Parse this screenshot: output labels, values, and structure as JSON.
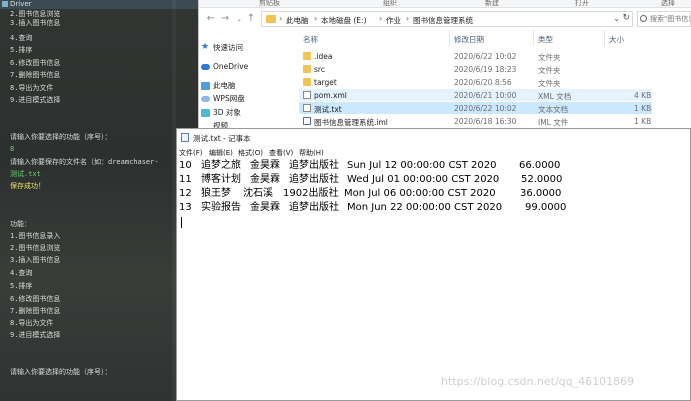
{
  "console": {
    "title": "Driver",
    "lines_top": [
      "2.图书信息浏览",
      "3.插入图书信息",
      "4.查询",
      "5.排序",
      "6.修改图书信息",
      "7.删除图书信息",
      "8.导出为文件",
      "9.进目模式选择"
    ],
    "prompt_function": "请输入你要选择的功能（序号）：",
    "input_value": "8",
    "prompt_filename": "请输入你要保存的文件名（如：dreamchaser-",
    "filename_value": "测试.txt",
    "save_success": "保存成功！",
    "function_header": "功能：",
    "lines_bottom": [
      "1.图书信息录入",
      "2.图书信息浏览",
      "3.插入图书信息",
      "4.查询",
      "5.排序",
      "6.修改图书信息",
      "7.删除图书信息",
      "8.导出为文件",
      "9.进目模式选择"
    ],
    "prompt_function_2": "请输入你要选择的功能（序号）："
  },
  "explorer": {
    "ribbon": [
      "剪贴板",
      "组织",
      "新建",
      "打开",
      "选择"
    ],
    "breadcrumbs": [
      "此电脑",
      "本地磁盘 (E:)",
      "作业",
      "图书信息管理系统"
    ],
    "search_placeholder": "搜索\"图书信息",
    "nav_items": [
      "快速访问",
      "OneDrive",
      "此电脑",
      "WPS网盘",
      "3D 对象",
      "视频"
    ],
    "columns": {
      "name": "名称",
      "date": "修改日期",
      "type": "类型",
      "size": "大小"
    },
    "files": [
      {
        "name": ".idea",
        "date": "2020/6/22 10:02",
        "type": "文件夹",
        "size": "",
        "icon": "folder"
      },
      {
        "name": "src",
        "date": "2020/6/19 18:23",
        "type": "文件夹",
        "size": "",
        "icon": "folder"
      },
      {
        "name": "target",
        "date": "2020/6/20 8:56",
        "type": "文件夹",
        "size": "",
        "icon": "folder"
      },
      {
        "name": "pom.xml",
        "date": "2020/6/21 10:00",
        "type": "XML 文档",
        "size": "4 KB",
        "icon": "file"
      },
      {
        "name": "测试.txt",
        "date": "2020/6/22 10:02",
        "type": "文本文档",
        "size": "1 KB",
        "icon": "file"
      },
      {
        "name": "图书信息管理系统.iml",
        "date": "2020/6/18 16:30",
        "type": "IML 文件",
        "size": "1 KB",
        "icon": "iml"
      }
    ]
  },
  "notepad": {
    "title": "测试.txt - 记事本",
    "menu": [
      "文件(F)",
      "编辑(E)",
      "格式(O)",
      "查看(V)",
      "帮助(H)"
    ],
    "rows": [
      {
        "id": "10",
        "title": "追梦之旅",
        "author": "金昊霖",
        "publisher": "追梦出版社",
        "date": "Sun Jul 12 00:00:00 CST 2020",
        "price": "66.0000"
      },
      {
        "id": "11",
        "title": "博客计划",
        "author": "金昊霖",
        "publisher": "追梦出版社",
        "date": "Wed Jul 01 00:00:00 CST 2020",
        "price": "52.0000"
      },
      {
        "id": "12",
        "title": "狼王梦",
        "author": "沈石溪",
        "publisher": "1902出版社",
        "date": "Mon Jul 06 00:00:00 CST 2020",
        "price": "36.0000"
      },
      {
        "id": "13",
        "title": "实验报告",
        "author": "金昊霖",
        "publisher": "追梦出版社",
        "date": "Mon Jun 22 00:00:00 CST 2020",
        "price": "99.0000"
      }
    ]
  },
  "watermark": "https://blog.csdn.net/qq_46101869"
}
